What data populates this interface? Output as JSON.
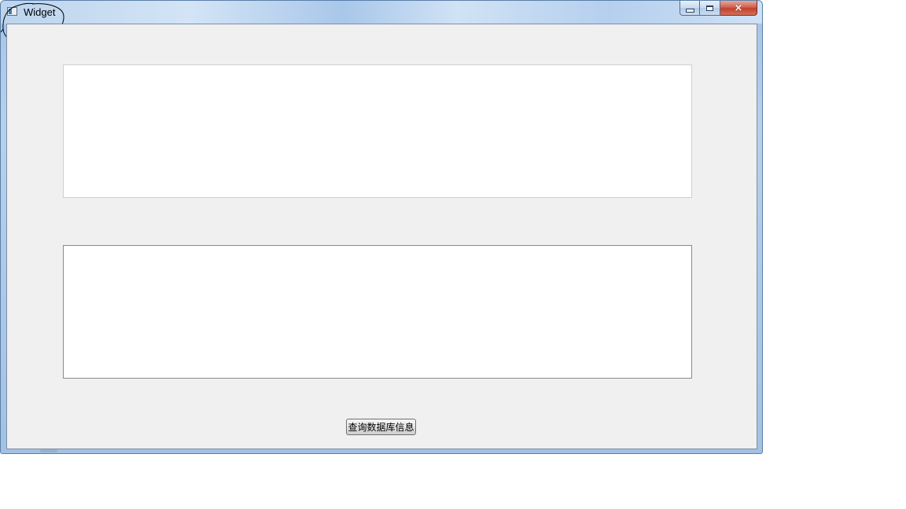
{
  "window": {
    "title": "Widget",
    "caption_buttons": {
      "minimize": "minimize",
      "maximize": "maximize",
      "close": "×"
    }
  },
  "main": {
    "top_text_area_value": "",
    "bottom_text_area_value": "",
    "query_button_label": "查询数据库信息"
  },
  "colors": {
    "window_frame": "#a9c6e8",
    "client_background": "#f0f0f0",
    "close_button": "#c2402a",
    "annotation_stroke": "#000000"
  }
}
